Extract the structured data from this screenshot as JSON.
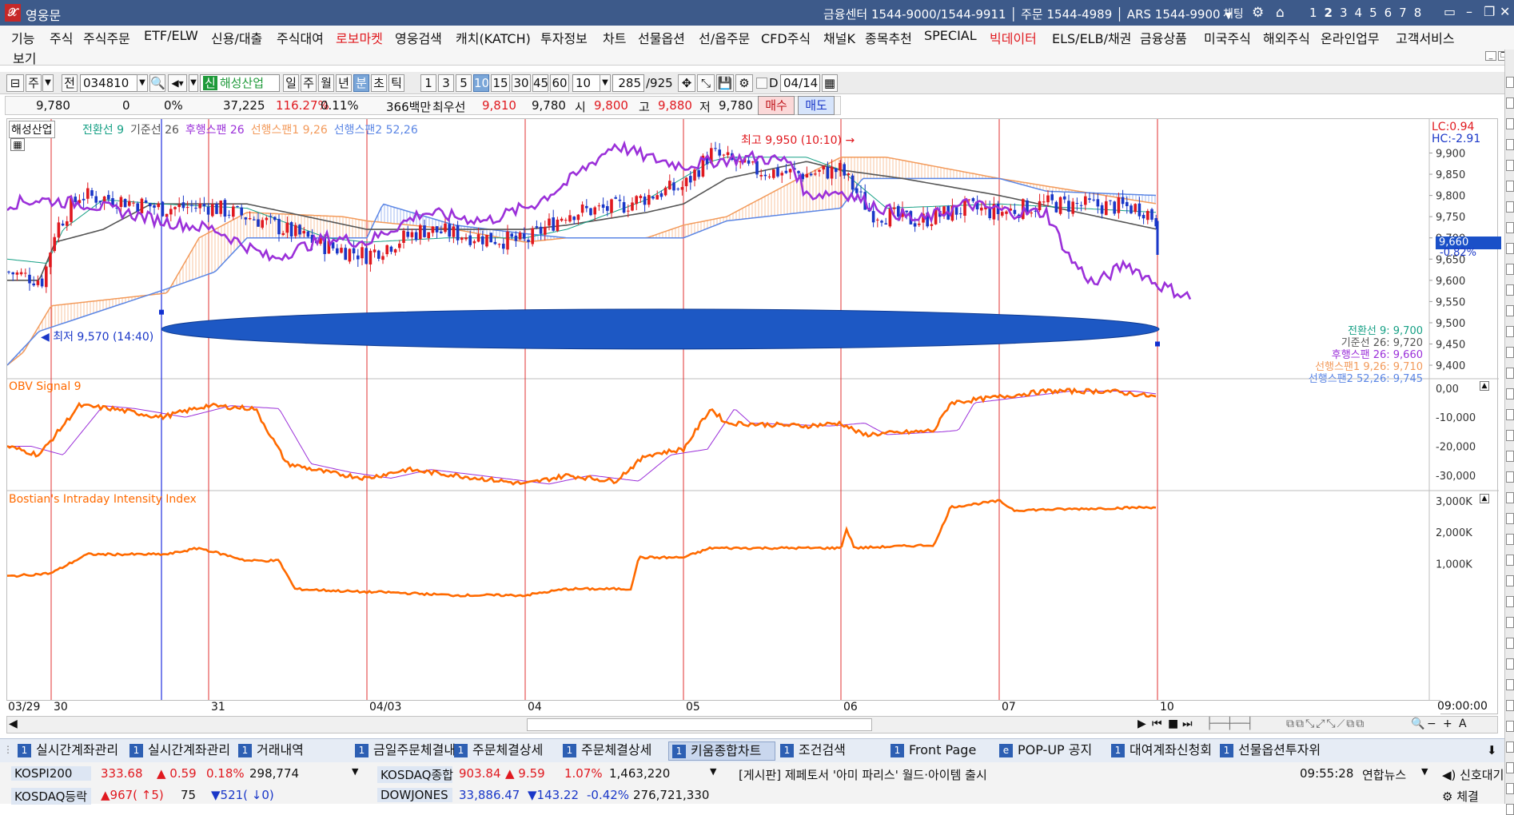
{
  "app": {
    "title": "영웅문",
    "call_center": "금융센터 1544-9000/1544-9911 │ 주문 1544-4989 │ ARS 1544-9900",
    "chat_label": "채팅",
    "screen_numbers": [
      "1",
      "2",
      "3",
      "4",
      "5",
      "6",
      "7",
      "8"
    ]
  },
  "menu": {
    "items": [
      {
        "label": "기능",
        "red": false
      },
      {
        "label": "주식",
        "red": false
      },
      {
        "label": "주식주문",
        "red": false
      },
      {
        "label": "ETF/ELW",
        "red": false
      },
      {
        "label": "신용/대출",
        "red": false
      },
      {
        "label": "주식대여",
        "red": false
      },
      {
        "label": "로보마켓",
        "red": true
      },
      {
        "label": "영웅검색",
        "red": false
      },
      {
        "label": "캐치(KATCH)",
        "red": false
      },
      {
        "label": "투자정보",
        "red": false
      },
      {
        "label": "차트",
        "red": false
      },
      {
        "label": "선물옵션",
        "red": false
      },
      {
        "label": "선/옵주문",
        "red": false
      },
      {
        "label": "CFD주식",
        "red": false
      },
      {
        "label": "채널K",
        "red": false
      },
      {
        "label": "종목추천",
        "red": false
      },
      {
        "label": "SPECIAL",
        "red": false
      },
      {
        "label": "빅데이터",
        "red": true
      },
      {
        "label": "ELS/ELB/채권",
        "red": false
      },
      {
        "label": "금융상품",
        "red": false
      },
      {
        "label": "미국주식",
        "red": false
      },
      {
        "label": "해외주식",
        "red": false
      },
      {
        "label": "온라인업무",
        "red": false
      },
      {
        "label": "고객서비스",
        "red": false
      }
    ],
    "second_row": "보기"
  },
  "toolbar": {
    "type1": "주",
    "type2": "전",
    "code": "034810",
    "badge": "신",
    "stock_name": "해성산업",
    "periods": [
      "일",
      "주",
      "월",
      "년",
      "분",
      "초",
      "틱"
    ],
    "active_period": "분",
    "intervals": [
      "1",
      "3",
      "5",
      "10",
      "15",
      "30",
      "45",
      "60"
    ],
    "active_interval": "10",
    "interval_value": "10",
    "count": "285",
    "count_total": "/925",
    "d_label": "D",
    "date": "04/14"
  },
  "pricebar": {
    "price": "9,780",
    "change": "0",
    "change_pct": "0%",
    "volume": "37,225",
    "volume_ratio": "116.27%",
    "turnover": "0.11%",
    "amount": "366백만",
    "best_label": "최우선",
    "best_ask": "9,810",
    "best_bid": "9,780",
    "open_label": "시",
    "open": "9,800",
    "high_label": "고",
    "high": "9,880",
    "low_label": "저",
    "low": "9,780",
    "buy_label": "매수",
    "sell_label": "매도"
  },
  "chart": {
    "name": "해성산업",
    "legend": [
      {
        "text": "전환선 9",
        "color": "#16a085"
      },
      {
        "text": "기준선 26",
        "color": "#555555"
      },
      {
        "text": "후행스팬 26",
        "color": "#9b30d9"
      },
      {
        "text": "선행스팬1 9,26",
        "color": "#f39a5a"
      },
      {
        "text": "선행스팬2 52,26",
        "color": "#5b86e5"
      }
    ],
    "lc_label": "LC:0.94",
    "hc_label": "HC:-2.91",
    "high_annotation": "최고 9,950 (10:10)",
    "low_annotation": "최저 9,570 (14:40)",
    "current_price": "9,660",
    "current_pct": "-0.82%",
    "value_labels": [
      {
        "text": "전환선 9: 9,700",
        "color": "#16a085"
      },
      {
        "text": "기준선 26: 9,720",
        "color": "#555555"
      },
      {
        "text": "후행스팬 26: 9,660",
        "color": "#9b30d9"
      },
      {
        "text": "선행스팬1 9,26: 9,710",
        "color": "#f39a5a"
      },
      {
        "text": "선행스팬2 52,26: 9,745",
        "color": "#5b86e5"
      }
    ],
    "price_ticks": [
      "9,900",
      "9,850",
      "9,800",
      "9,750",
      "9,700",
      "9,650",
      "9,600",
      "9,550",
      "9,500",
      "9,450",
      "9,400"
    ],
    "obv_title": "OBV  Signal 9",
    "obv_ticks": [
      "0,00",
      "-10,000",
      "-20,000",
      "-30,000"
    ],
    "bii_title": "Bostian's Intraday Intensity Index",
    "bii_ticks": [
      "3,000K",
      "2,000K",
      "1,000K"
    ],
    "x_labels": [
      "03/29",
      "30",
      "31",
      "04/03",
      "04",
      "05",
      "06",
      "07",
      "10"
    ],
    "x_time": "09:00:00"
  },
  "chart_data": {
    "type": "candlestick",
    "interval": "10분",
    "price_ylim": [
      9370,
      9980
    ],
    "price_series": [
      "전환선 9",
      "기준선 26",
      "후행스팬 26",
      "선행스팬1 9,26",
      "선행스팬2 52,26"
    ],
    "current": {
      "전환선 9": 9700,
      "기준선 26": 9720,
      "후행스팬 26": 9660,
      "선행스팬1 9,26": 9710,
      "선행스팬2 52,26": 9745
    },
    "high": 9950,
    "low": 9570,
    "obv_ylim": [
      -35000,
      3000
    ],
    "bii_ylim": [
      0,
      3300000
    ],
    "days": [
      "03/29",
      "30",
      "31",
      "04/03",
      "04",
      "05",
      "06",
      "07",
      "10"
    ]
  },
  "tabs": [
    {
      "n": "1",
      "label": "실시간계좌관리"
    },
    {
      "n": "1",
      "label": "실시간계좌관리"
    },
    {
      "n": "1",
      "label": "거래내역"
    },
    {
      "n": "1",
      "label": "금일주문체결내"
    },
    {
      "n": "1",
      "label": "주문체결상세"
    },
    {
      "n": "1",
      "label": "주문체결상세"
    },
    {
      "n": "1",
      "label": "키움종합차트"
    },
    {
      "n": "1",
      "label": "조건검색"
    },
    {
      "n": "1",
      "label": "Front Page"
    },
    {
      "n": "e",
      "label": "POP-UP 공지"
    },
    {
      "n": "1",
      "label": "대여계좌신청회"
    },
    {
      "n": "1",
      "label": "선물옵션투자위"
    }
  ],
  "active_tab": "키움종합차트",
  "ticker": {
    "kospi200_label": "KOSPI200",
    "kospi200": "333.68",
    "kospi200_chg": "▲ 0.59",
    "kospi200_pct": "0.18%",
    "kospi200_vol": "298,774",
    "kosdaq_label": "KOSDAQ종합",
    "kosdaq": "903.84",
    "kosdaq_chg": "▲ 9.59",
    "kosdaq_pct": "1.07%",
    "kosdaq_vol": "1,463,220",
    "news": "[게시판] 제페토서 '아미 파리스' 월드·아이템 출시",
    "time": "09:55:28",
    "news_src": "연합뉴스",
    "signal": "신호대기",
    "row2_label": "KOSDAQ등락",
    "row2_a": "▲967( ↑5)",
    "row2_b": "75",
    "row2_c": "▼521( ↓0)",
    "dow_label": "DOWJONES",
    "dow": "33,886.47",
    "dow_chg": "▼143.22",
    "dow_pct": "-0.42%",
    "dow_vol": "276,721,330",
    "bottom_right": "체결"
  },
  "colors": {
    "up": "#e0191f",
    "down": "#1a37c8",
    "tenkan": "#16a085",
    "kijun": "#555555",
    "chikou": "#9b30d9",
    "span1": "#f39a5a",
    "span2": "#5b86e5",
    "obv": "#ff6a00",
    "signal": "#9b30d9",
    "bii": "#ff6a00",
    "vline": "#e03030"
  }
}
